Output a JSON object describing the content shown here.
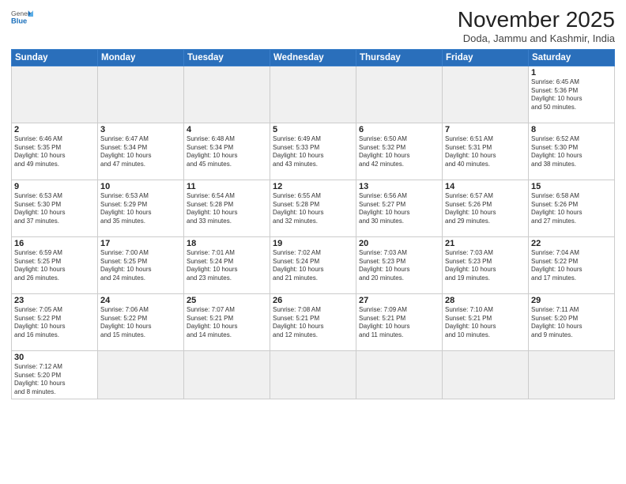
{
  "header": {
    "logo_general": "General",
    "logo_blue": "Blue",
    "month_title": "November 2025",
    "location": "Doda, Jammu and Kashmir, India"
  },
  "weekdays": [
    "Sunday",
    "Monday",
    "Tuesday",
    "Wednesday",
    "Thursday",
    "Friday",
    "Saturday"
  ],
  "weeks": [
    [
      {
        "day": "",
        "info": ""
      },
      {
        "day": "",
        "info": ""
      },
      {
        "day": "",
        "info": ""
      },
      {
        "day": "",
        "info": ""
      },
      {
        "day": "",
        "info": ""
      },
      {
        "day": "",
        "info": ""
      },
      {
        "day": "1",
        "info": "Sunrise: 6:45 AM\nSunset: 5:36 PM\nDaylight: 10 hours\nand 50 minutes."
      }
    ],
    [
      {
        "day": "2",
        "info": "Sunrise: 6:46 AM\nSunset: 5:35 PM\nDaylight: 10 hours\nand 49 minutes."
      },
      {
        "day": "3",
        "info": "Sunrise: 6:47 AM\nSunset: 5:34 PM\nDaylight: 10 hours\nand 47 minutes."
      },
      {
        "day": "4",
        "info": "Sunrise: 6:48 AM\nSunset: 5:34 PM\nDaylight: 10 hours\nand 45 minutes."
      },
      {
        "day": "5",
        "info": "Sunrise: 6:49 AM\nSunset: 5:33 PM\nDaylight: 10 hours\nand 43 minutes."
      },
      {
        "day": "6",
        "info": "Sunrise: 6:50 AM\nSunset: 5:32 PM\nDaylight: 10 hours\nand 42 minutes."
      },
      {
        "day": "7",
        "info": "Sunrise: 6:51 AM\nSunset: 5:31 PM\nDaylight: 10 hours\nand 40 minutes."
      },
      {
        "day": "8",
        "info": "Sunrise: 6:52 AM\nSunset: 5:30 PM\nDaylight: 10 hours\nand 38 minutes."
      }
    ],
    [
      {
        "day": "9",
        "info": "Sunrise: 6:53 AM\nSunset: 5:30 PM\nDaylight: 10 hours\nand 37 minutes."
      },
      {
        "day": "10",
        "info": "Sunrise: 6:53 AM\nSunset: 5:29 PM\nDaylight: 10 hours\nand 35 minutes."
      },
      {
        "day": "11",
        "info": "Sunrise: 6:54 AM\nSunset: 5:28 PM\nDaylight: 10 hours\nand 33 minutes."
      },
      {
        "day": "12",
        "info": "Sunrise: 6:55 AM\nSunset: 5:28 PM\nDaylight: 10 hours\nand 32 minutes."
      },
      {
        "day": "13",
        "info": "Sunrise: 6:56 AM\nSunset: 5:27 PM\nDaylight: 10 hours\nand 30 minutes."
      },
      {
        "day": "14",
        "info": "Sunrise: 6:57 AM\nSunset: 5:26 PM\nDaylight: 10 hours\nand 29 minutes."
      },
      {
        "day": "15",
        "info": "Sunrise: 6:58 AM\nSunset: 5:26 PM\nDaylight: 10 hours\nand 27 minutes."
      }
    ],
    [
      {
        "day": "16",
        "info": "Sunrise: 6:59 AM\nSunset: 5:25 PM\nDaylight: 10 hours\nand 26 minutes."
      },
      {
        "day": "17",
        "info": "Sunrise: 7:00 AM\nSunset: 5:25 PM\nDaylight: 10 hours\nand 24 minutes."
      },
      {
        "day": "18",
        "info": "Sunrise: 7:01 AM\nSunset: 5:24 PM\nDaylight: 10 hours\nand 23 minutes."
      },
      {
        "day": "19",
        "info": "Sunrise: 7:02 AM\nSunset: 5:24 PM\nDaylight: 10 hours\nand 21 minutes."
      },
      {
        "day": "20",
        "info": "Sunrise: 7:03 AM\nSunset: 5:23 PM\nDaylight: 10 hours\nand 20 minutes."
      },
      {
        "day": "21",
        "info": "Sunrise: 7:03 AM\nSunset: 5:23 PM\nDaylight: 10 hours\nand 19 minutes."
      },
      {
        "day": "22",
        "info": "Sunrise: 7:04 AM\nSunset: 5:22 PM\nDaylight: 10 hours\nand 17 minutes."
      }
    ],
    [
      {
        "day": "23",
        "info": "Sunrise: 7:05 AM\nSunset: 5:22 PM\nDaylight: 10 hours\nand 16 minutes."
      },
      {
        "day": "24",
        "info": "Sunrise: 7:06 AM\nSunset: 5:22 PM\nDaylight: 10 hours\nand 15 minutes."
      },
      {
        "day": "25",
        "info": "Sunrise: 7:07 AM\nSunset: 5:21 PM\nDaylight: 10 hours\nand 14 minutes."
      },
      {
        "day": "26",
        "info": "Sunrise: 7:08 AM\nSunset: 5:21 PM\nDaylight: 10 hours\nand 12 minutes."
      },
      {
        "day": "27",
        "info": "Sunrise: 7:09 AM\nSunset: 5:21 PM\nDaylight: 10 hours\nand 11 minutes."
      },
      {
        "day": "28",
        "info": "Sunrise: 7:10 AM\nSunset: 5:21 PM\nDaylight: 10 hours\nand 10 minutes."
      },
      {
        "day": "29",
        "info": "Sunrise: 7:11 AM\nSunset: 5:20 PM\nDaylight: 10 hours\nand 9 minutes."
      }
    ],
    [
      {
        "day": "30",
        "info": "Sunrise: 7:12 AM\nSunset: 5:20 PM\nDaylight: 10 hours\nand 8 minutes."
      },
      {
        "day": "",
        "info": ""
      },
      {
        "day": "",
        "info": ""
      },
      {
        "day": "",
        "info": ""
      },
      {
        "day": "",
        "info": ""
      },
      {
        "day": "",
        "info": ""
      },
      {
        "day": "",
        "info": ""
      }
    ]
  ]
}
